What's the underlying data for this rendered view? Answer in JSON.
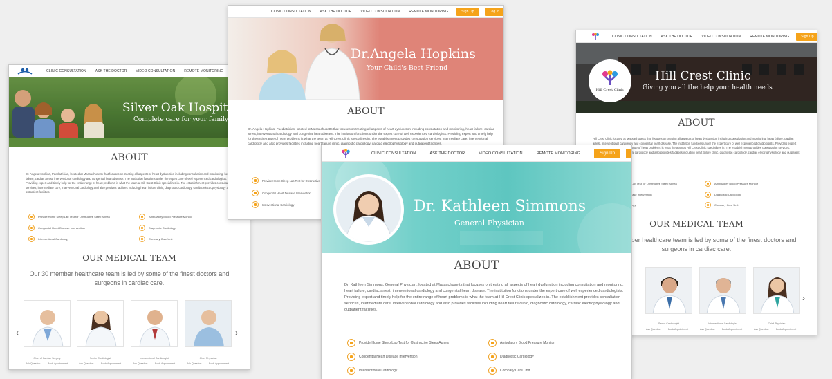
{
  "nav": {
    "items": [
      "CLINIC CONSULTATION",
      "ASK THE DOCTOR",
      "VIDEO CONSULTATION",
      "REMOTE MONITORING"
    ],
    "signup": "Sign Up",
    "login": "Log In"
  },
  "silver": {
    "title": "Silver Oak Hospital",
    "subtitle": "Complete care for your family",
    "about": "ABOUT",
    "about_text": "Dr. Angela Hopkins, Paediatrician, located at Massachusetts that focuses on treating all aspects of heart dysfunction including consultation and monitoring, heart failure, cardiac arrest, interventional cardiology and congenital heart disease. The institution functions under the expert care of well experienced cardiologists. Providing expert and timely help for the entire range of heart problems is what the team at Hill Crest Clinic specializes in. The establishment provides consultation services, intermediate care, interventional cardiology and also provides facilities including heart failure clinic, diagnostic cardiology, cardiac electrophysiology and outpatient facilities.",
    "features": [
      "Provide Home Sleep Lab Test for Obstructive Sleep Apnea",
      "Ambulatory Blood Pressure Monitor",
      "Congenital Heart Disease Intervention",
      "Diagnostic Cardiology",
      "Interventional Cardiology",
      "Coronary Care Unit"
    ],
    "team_title": "OUR MEDICAL TEAM",
    "team_text": "Our 30 member healthcare team is led by some of the finest doctors and surgeons in cardiac care.",
    "doctors": [
      "Chief of Cardiac Surgery",
      "Senior Cardiologist",
      "Interventional Cardiologist",
      "Chief Physician"
    ],
    "actions": [
      "Ask Question",
      "Book Appointment"
    ]
  },
  "angela": {
    "title": "Dr.Angela Hopkins",
    "subtitle": "Your Child's Best Friend",
    "about": "ABOUT",
    "about_text": "Dr. Angela Hopkins, Paediatrician, located at Massachusetts that focuses on treating all aspects of heart dysfunction including consultation and monitoring, heart failure, cardiac arrest, interventional cardiology and congenital heart disease. The institution functions under the expert care of well experienced cardiologists. Providing expert and timely help for the entire range of heart problems is what the team at Hill Crest Clinic specializes in. The establishment provides consultation services, intermediate care, interventional cardiology and also provides facilities including heart failure clinic, diagnostic cardiology, cardiac electrophysiology and outpatient facilities.",
    "features": [
      "Provide Home Sleep Lab Test for Obstructive Sleep Apnea",
      "Congenital Heart Disease Intervention",
      "Interventional Cardiology"
    ]
  },
  "hill": {
    "title": "Hill Crest Clinic",
    "subtitle": "Giving you all the help your health needs",
    "logo_text": "Hill Crest Clinic",
    "about": "ABOUT",
    "about_text": "Hill Crest Clinic located at Massachusetts that focuses on treating all aspects of heart dysfunction including consultation and monitoring, heart failure, cardiac arrest, interventional cardiology and congenital heart disease. The institution functions under the expert care of well experienced cardiologists. Providing expert and timely help for the entire range of heart problems is what the team at Hill Crest Clinic specializes in. The establishment provides consultation services, intermediate care, interventional cardiology and also provides facilities including heart failure clinic, diagnostic cardiology, cardiac electrophysiology and outpatient facilities.",
    "features": [
      "Provide Home Sleep Lab Test for Obstructive Sleep Apnea",
      "Ambulatory Blood Pressure Monitor",
      "Congenital Heart Disease Intervention",
      "Diagnostic Cardiology",
      "Interventional Cardiology",
      "Coronary Care Unit"
    ],
    "team_title": "OUR MEDICAL TEAM",
    "team_text": "Our 30 member healthcare team is led by some of the finest doctors and surgeons in cardiac care.",
    "doctors": [
      "Senior Cardiologist",
      "Interventional Cardiologist",
      "Chief Physician"
    ],
    "actions": [
      "Ask Question",
      "Book Appointment"
    ]
  },
  "kathleen": {
    "title": "Dr. Kathleen Simmons",
    "subtitle": "General Physician",
    "about": "ABOUT",
    "about_text": "Dr. Kathleen Simmons, General Physician, located at Massachusetts that focuses on treating all aspects of heart dysfunction including consultation and monitoring, heart failure, cardiac arrest, interventional cardiology and congenital heart disease. The institution functions under the expert care of well experienced cardiologists. Providing expert and timely help for the entire range of heart problems is what the team at Hill Crest Clinic specializes in. The establishment provides consultation services, intermediate care, interventional cardiology and also provides facilities including heart failure clinic, diagnostic cardiology, cardiac electrophysiology and outpatient facilities.",
    "features": [
      "Provide Home Sleep Lab Test for Obstructive Sleep Apnea",
      "Ambulatory Blood Pressure Monitor",
      "Congenital Heart Disease Intervention",
      "Diagnostic Cardiology",
      "Interventional Cardiology",
      "Coronary Care Unit"
    ]
  },
  "arrows": {
    "prev": "‹",
    "next": "›"
  },
  "colors": {
    "accent": "#f5a31a",
    "angela_hero": "#df8478",
    "kathleen_hero": "#6fcfc9",
    "hill_hero": "#3b3b3b"
  }
}
